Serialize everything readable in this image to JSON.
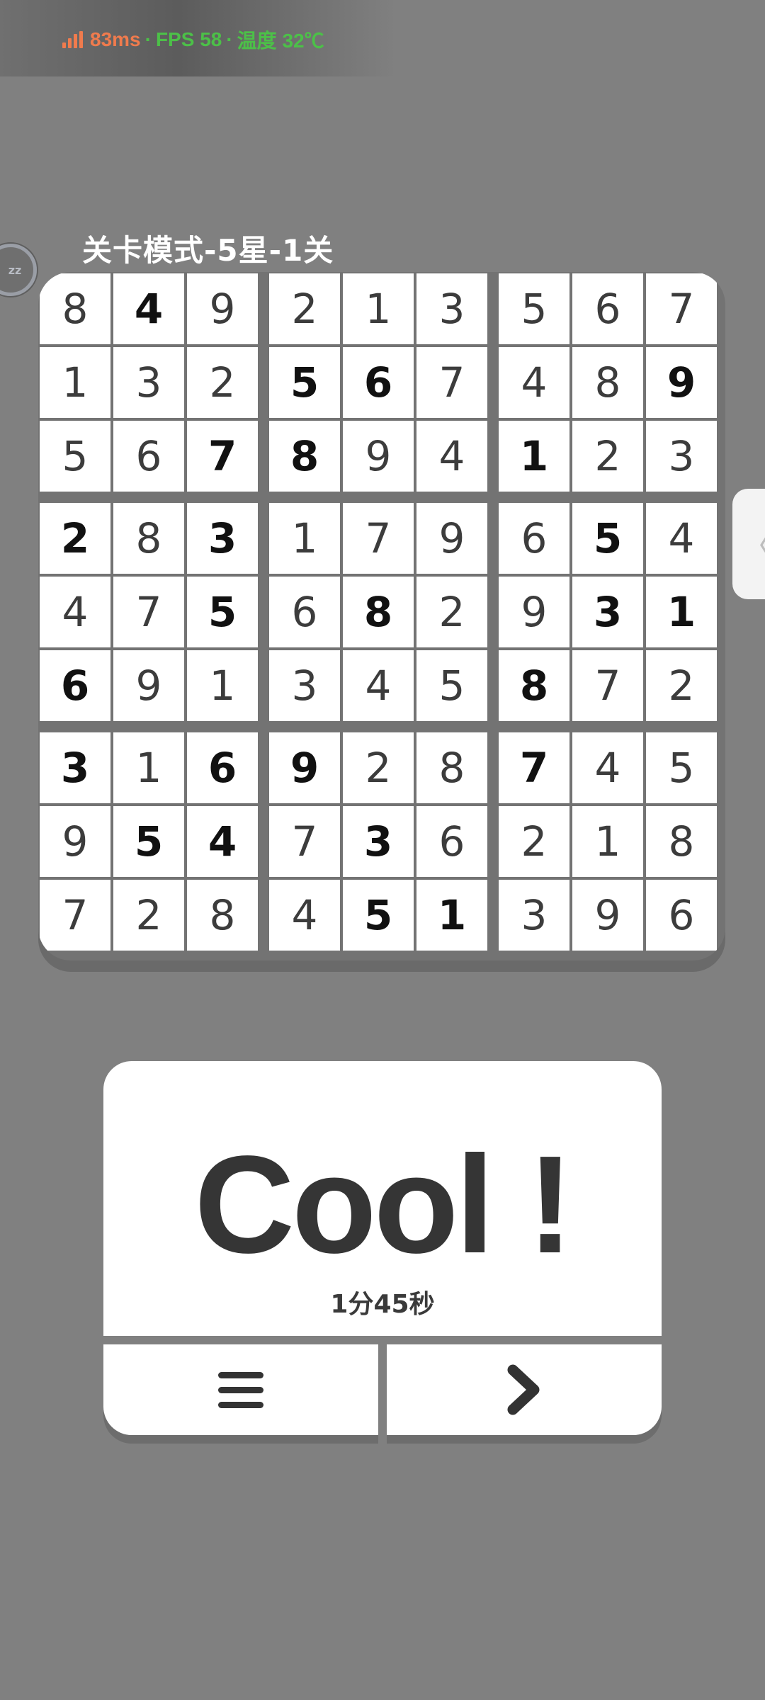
{
  "status_overlay": {
    "latency": "83ms",
    "separator": "·",
    "fps": "FPS 58",
    "temperature": "温度 32℃"
  },
  "floating_ball": {
    "label": "zz"
  },
  "side_tab": {
    "label": "〈"
  },
  "level": {
    "title": "关卡模式-5星-1关"
  },
  "board": {
    "grid": [
      [
        8,
        4,
        9,
        2,
        1,
        3,
        5,
        6,
        7
      ],
      [
        1,
        3,
        2,
        5,
        6,
        7,
        4,
        8,
        9
      ],
      [
        5,
        6,
        7,
        8,
        9,
        4,
        1,
        2,
        3
      ],
      [
        2,
        8,
        3,
        1,
        7,
        9,
        6,
        5,
        4
      ],
      [
        4,
        7,
        5,
        6,
        8,
        2,
        9,
        3,
        1
      ],
      [
        6,
        9,
        1,
        3,
        4,
        5,
        8,
        7,
        2
      ],
      [
        3,
        1,
        6,
        9,
        2,
        8,
        7,
        4,
        5
      ],
      [
        9,
        5,
        4,
        7,
        3,
        6,
        2,
        1,
        8
      ],
      [
        7,
        2,
        8,
        4,
        5,
        1,
        3,
        9,
        6
      ]
    ],
    "given": [
      [
        0,
        1,
        0,
        0,
        0,
        0,
        0,
        0,
        0
      ],
      [
        0,
        0,
        0,
        1,
        1,
        0,
        0,
        0,
        1
      ],
      [
        0,
        0,
        1,
        1,
        0,
        0,
        1,
        0,
        0
      ],
      [
        1,
        0,
        1,
        0,
        0,
        0,
        0,
        1,
        0
      ],
      [
        0,
        0,
        1,
        0,
        1,
        0,
        0,
        1,
        1
      ],
      [
        1,
        0,
        0,
        0,
        0,
        0,
        1,
        0,
        0
      ],
      [
        1,
        0,
        1,
        1,
        0,
        0,
        1,
        0,
        0
      ],
      [
        0,
        1,
        1,
        0,
        1,
        0,
        0,
        0,
        0
      ],
      [
        0,
        0,
        0,
        0,
        1,
        1,
        0,
        0,
        0
      ]
    ]
  },
  "result": {
    "title": "Cool !",
    "time": "1分45秒"
  },
  "buttons": {
    "menu_icon": "menu-icon",
    "next_icon": "chevron-right-icon"
  },
  "colors": {
    "background": "#808080",
    "latency": "#f07b4d",
    "fps": "#4cc048"
  }
}
